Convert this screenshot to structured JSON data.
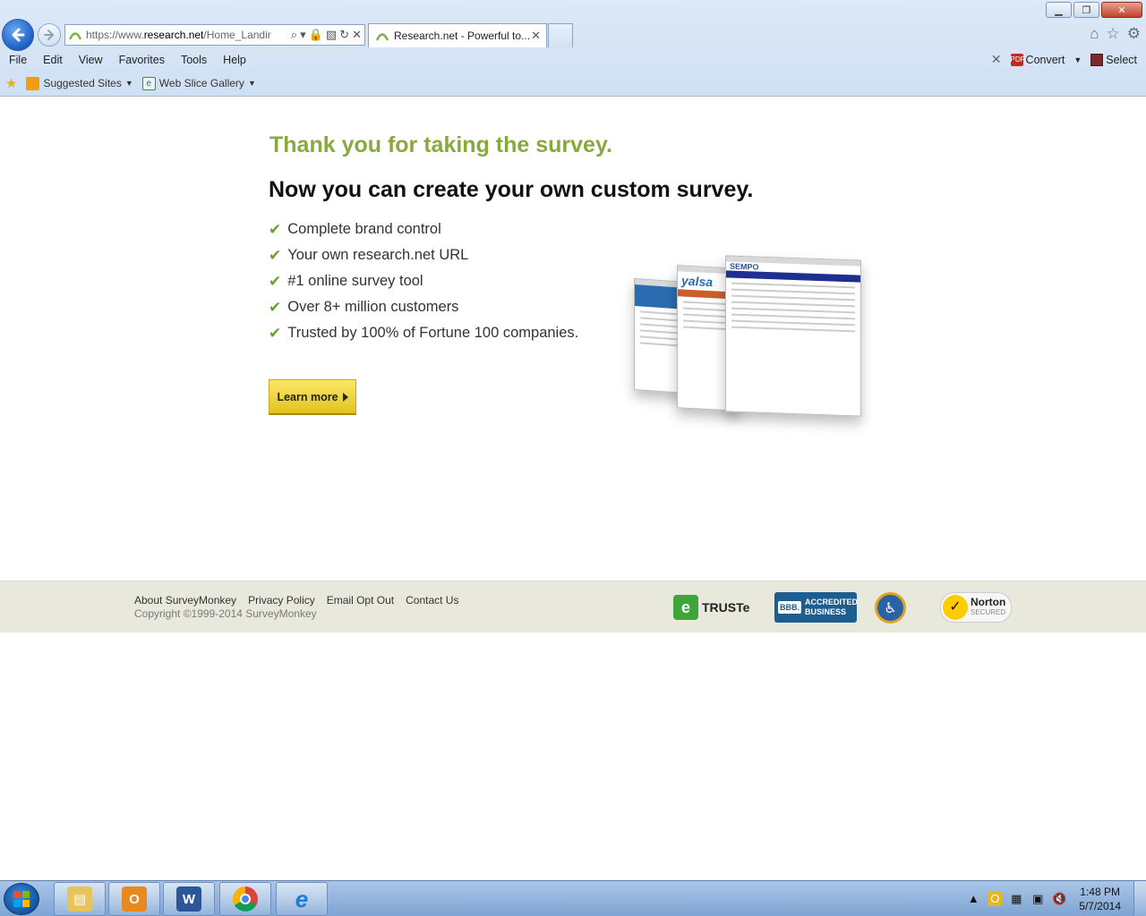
{
  "browser": {
    "url_prefix": "https://www.",
    "url_domain": "research.net",
    "url_path": "/Home_Landir",
    "tab_title": "Research.net - Powerful to...",
    "menu": [
      "File",
      "Edit",
      "View",
      "Favorites",
      "Tools",
      "Help"
    ],
    "convert_label": "Convert",
    "select_label": "Select",
    "favorites": {
      "suggested_sites": "Suggested Sites",
      "web_slice_gallery": "Web Slice Gallery"
    }
  },
  "page": {
    "thank_title": "Thank you for taking the survey.",
    "main_title": "Now you can create your own custom survey.",
    "features": [
      "Complete brand control",
      "Your own research.net URL",
      "#1 online survey tool",
      "Over 8+ million customers",
      "Trusted by 100% of Fortune 100 companies."
    ],
    "learn_more": "Learn more",
    "check_glyph": "✔",
    "accent_color": "#89a83d",
    "screens": {
      "logo_2": "yalsa",
      "logo_3": "SEMPO"
    }
  },
  "footer": {
    "links": [
      "About SurveyMonkey",
      "Privacy Policy",
      "Email Opt Out",
      "Contact Us"
    ],
    "copyright": "Copyright ©1999-2014 SurveyMonkey",
    "badges": {
      "truste": "TRUSTe",
      "bbb_1": "ACCREDITED",
      "bbb_2": "BUSINESS",
      "bbb_tag": "BBB.",
      "norton": "Norton",
      "norton_sub": "SECURED"
    }
  },
  "taskbar": {
    "time": "1:48 PM",
    "date": "5/7/2014",
    "apps": [
      "file-explorer",
      "outlook",
      "word",
      "chrome",
      "internet-explorer"
    ]
  },
  "icons": {
    "back": "back-arrow-icon",
    "forward": "forward-arrow-icon",
    "home": "home-icon",
    "favorites": "star-icon",
    "settings": "gear-icon"
  }
}
